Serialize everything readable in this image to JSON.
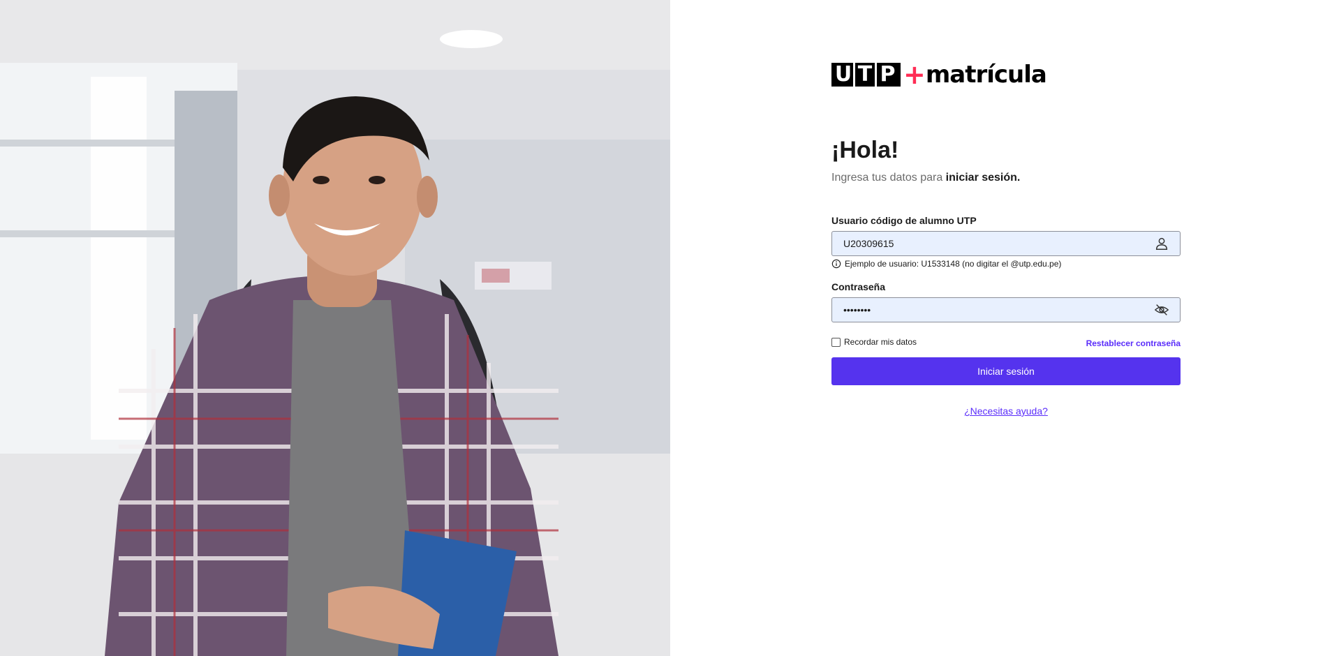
{
  "logo": {
    "letters": [
      "U",
      "T",
      "P"
    ],
    "plus": "+",
    "word": "matrícula"
  },
  "login": {
    "greeting": "¡Hola!",
    "subtitle_prefix": "Ingresa tus datos para ",
    "subtitle_bold": "iniciar sesión.",
    "username": {
      "label": "Usuario código de alumno UTP",
      "value": "U20309615",
      "icon": "user-icon"
    },
    "hint": "Ejemplo de usuario: U1533148 (no digitar el @utp.edu.pe)",
    "password": {
      "label": "Contraseña",
      "value": "••••••••",
      "icon": "eye-off-icon"
    },
    "remember_label": "Recordar mis datos",
    "remember_checked": false,
    "reset_link": "Restablecer contraseña",
    "submit_label": "Iniciar sesión",
    "help_link": "¿Necesitas ayuda?"
  },
  "colors": {
    "accent": "#5533ee",
    "link": "#5a2dfa",
    "logo_plus": "#ff2d55",
    "field_bg": "#e8f0fe"
  }
}
